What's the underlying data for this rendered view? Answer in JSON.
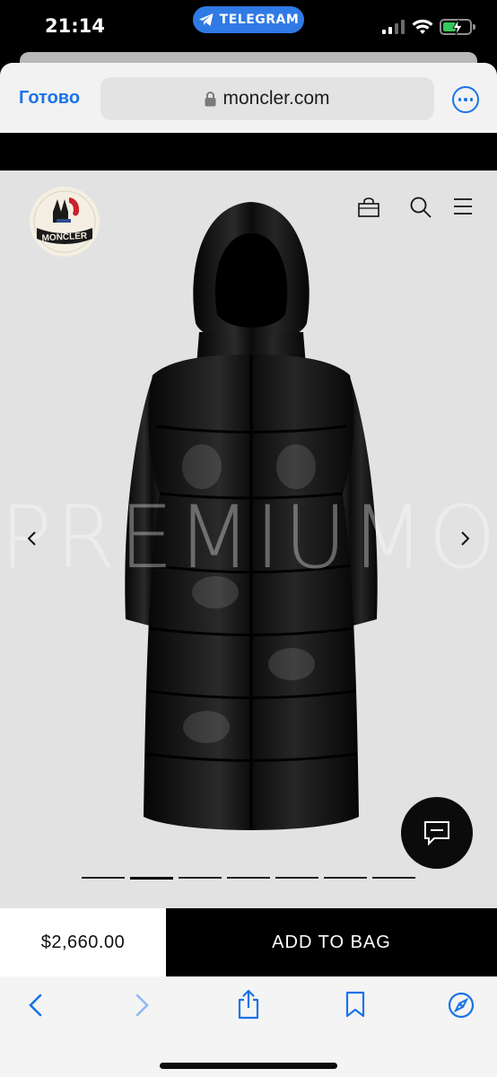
{
  "status_bar": {
    "time": "21:14",
    "telegram_label": "TELEGRAM",
    "icons": [
      "signal-icon",
      "wifi-icon",
      "battery-charging-icon"
    ]
  },
  "browser": {
    "done_label": "Готово",
    "url": "moncler.com",
    "lock_icon": "lock-icon",
    "more_icon": "more-icon",
    "accent_color": "#1a73e8"
  },
  "site": {
    "logo_text": "MONCLER",
    "header_icons": [
      "bag-icon",
      "search-icon",
      "menu-icon"
    ],
    "watermark": "PREMIUMO",
    "carousel": {
      "total": 7,
      "active": 2
    }
  },
  "purchase": {
    "price": "$2,660.00",
    "add_to_bag_label": "ADD TO BAG"
  },
  "toolbar": {
    "icons": [
      "back-icon",
      "forward-icon",
      "share-icon",
      "bookmarks-icon",
      "compass-icon"
    ]
  }
}
